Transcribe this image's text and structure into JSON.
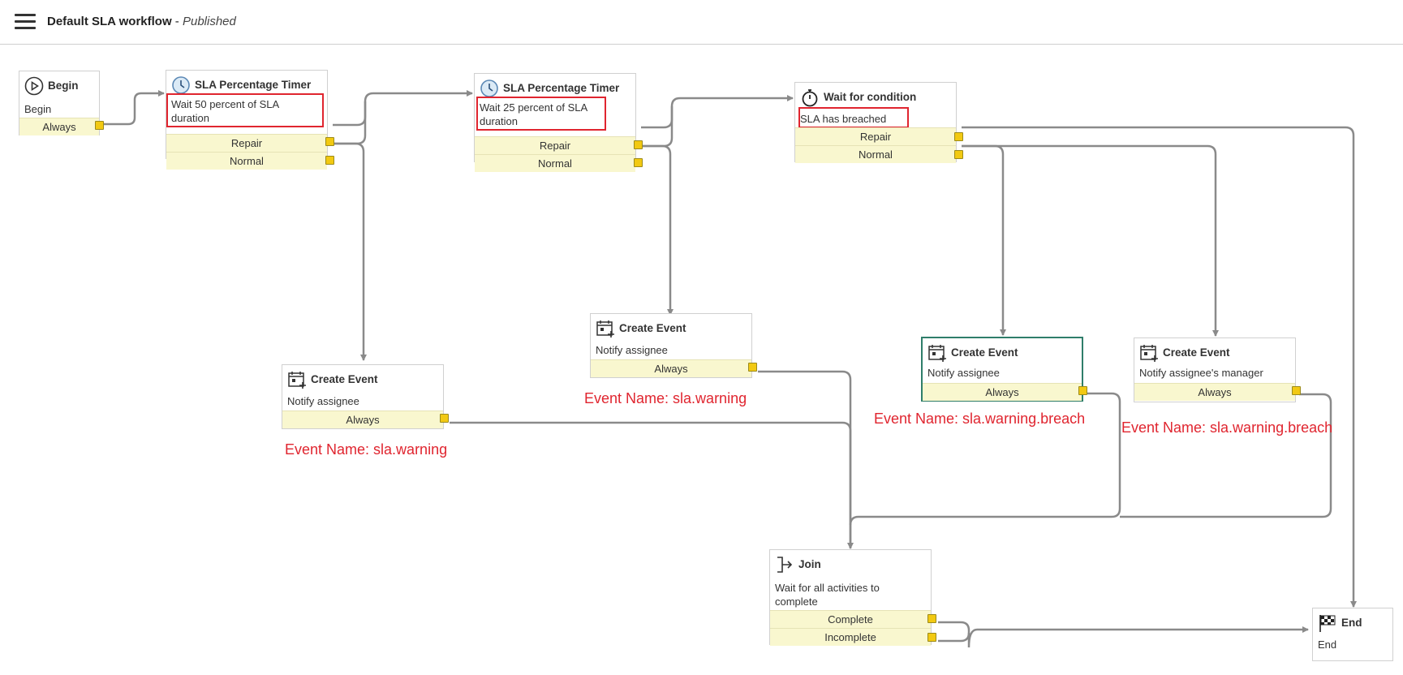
{
  "header": {
    "menu_icon": "hamburger-menu-icon",
    "workflow_name": "Default SLA workflow",
    "separator": " - ",
    "status": "Published"
  },
  "nodes": {
    "begin": {
      "title": "Begin",
      "desc": "Begin",
      "conditions": [
        "Always"
      ],
      "icon": "play-circle-icon"
    },
    "timer1": {
      "title": "SLA Percentage Timer",
      "desc": "Wait 50 percent of SLA duration",
      "conditions": [
        "Repair",
        "Normal"
      ],
      "icon": "clock-icon"
    },
    "timer2": {
      "title": "SLA Percentage Timer",
      "desc": "Wait 25 percent of SLA duration",
      "conditions": [
        "Repair",
        "Normal"
      ],
      "icon": "clock-icon"
    },
    "wait": {
      "title": "Wait for condition",
      "desc": "SLA has breached",
      "conditions": [
        "Repair",
        "Normal"
      ],
      "icon": "stopwatch-icon"
    },
    "event1": {
      "title": "Create Event",
      "desc": "Notify assignee",
      "conditions": [
        "Always"
      ],
      "icon": "calendar-add-icon",
      "annotation": "Event Name: sla.warning"
    },
    "event2": {
      "title": "Create Event",
      "desc": "Notify assignee",
      "conditions": [
        "Always"
      ],
      "icon": "calendar-add-icon",
      "annotation": "Event Name: sla.warning"
    },
    "event3": {
      "title": "Create Event",
      "desc": "Notify assignee",
      "conditions": [
        "Always"
      ],
      "icon": "calendar-add-icon",
      "annotation": "Event Name: sla.warning.breach"
    },
    "event4": {
      "title": "Create Event",
      "desc": "Notify assignee's manager",
      "conditions": [
        "Always"
      ],
      "icon": "calendar-add-icon",
      "annotation": "Event Name: sla.warning.breach"
    },
    "join": {
      "title": "Join",
      "desc": "Wait for all activities to complete",
      "conditions": [
        "Complete",
        "Incomplete"
      ],
      "icon": "join-arrow-icon"
    },
    "end": {
      "title": "End",
      "desc": "End",
      "icon": "checkered-flag-icon"
    }
  },
  "colors": {
    "condition_bg": "#f9f7cf",
    "port": "#f2c912",
    "wire": "#8a8a8a",
    "highlight": "#e0252f",
    "selected_border": "#2f7e6a"
  }
}
